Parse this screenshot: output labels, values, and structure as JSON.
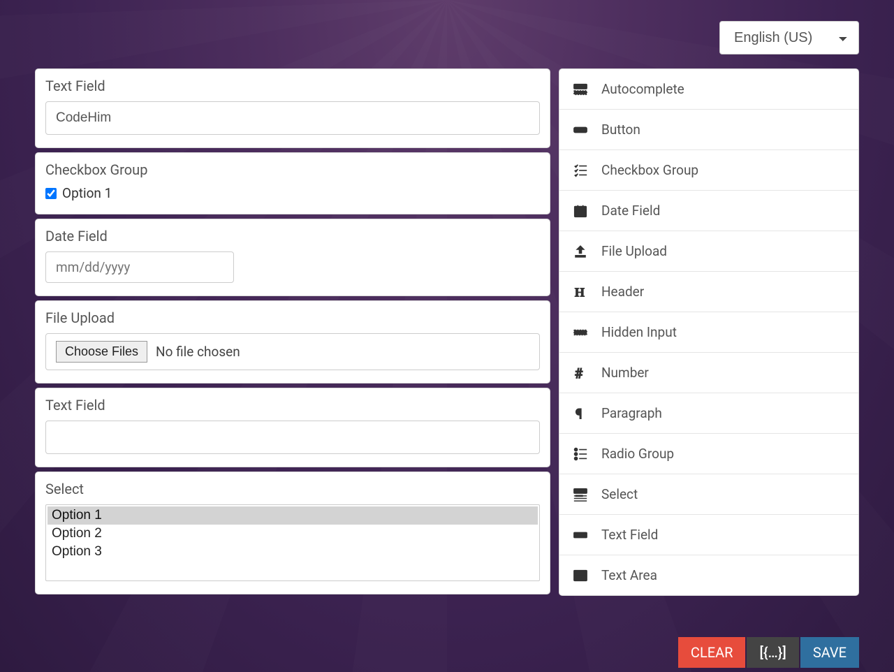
{
  "language": {
    "selected": "English (US)"
  },
  "palette": {
    "items": [
      {
        "label": "Autocomplete",
        "icon": "autocomplete"
      },
      {
        "label": "Button",
        "icon": "button"
      },
      {
        "label": "Checkbox Group",
        "icon": "checklist"
      },
      {
        "label": "Date Field",
        "icon": "calendar"
      },
      {
        "label": "File Upload",
        "icon": "upload"
      },
      {
        "label": "Header",
        "icon": "header"
      },
      {
        "label": "Hidden Input",
        "icon": "hidden"
      },
      {
        "label": "Number",
        "icon": "hash"
      },
      {
        "label": "Paragraph",
        "icon": "pilcrow"
      },
      {
        "label": "Radio Group",
        "icon": "radiolist"
      },
      {
        "label": "Select",
        "icon": "select"
      },
      {
        "label": "Text Field",
        "icon": "textfield"
      },
      {
        "label": "Text Area",
        "icon": "textarea"
      }
    ]
  },
  "canvas": {
    "blocks": [
      {
        "type": "text",
        "label": "Text Field",
        "value": "CodeHim"
      },
      {
        "type": "checkbox",
        "label": "Checkbox Group",
        "options": [
          {
            "label": "Option 1",
            "checked": true
          }
        ]
      },
      {
        "type": "date",
        "label": "Date Field",
        "placeholder": "mm/dd/yyyy"
      },
      {
        "type": "file",
        "label": "File Upload",
        "button": "Choose Files",
        "status": "No file chosen"
      },
      {
        "type": "text",
        "label": "Text Field",
        "value": ""
      },
      {
        "type": "select",
        "label": "Select",
        "options": [
          "Option 1",
          "Option 2",
          "Option 3"
        ],
        "selectedIndex": 0
      }
    ]
  },
  "footer": {
    "clear": "CLEAR",
    "data": "[{…}]",
    "save": "SAVE"
  }
}
